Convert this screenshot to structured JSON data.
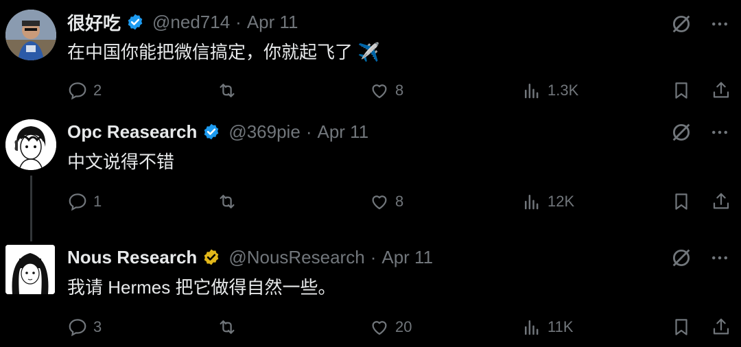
{
  "tweets": [
    {
      "name": "很好吃",
      "verified": "blue",
      "handle": "@ned714",
      "sep": "·",
      "time": "Apr 11",
      "text": "在中国你能把微信搞定，你就起飞了 ✈️",
      "replies": "2",
      "likes": "8",
      "views": "1.3K"
    },
    {
      "name": "Opc Reasearch",
      "verified": "blue",
      "handle": "@369pie",
      "sep": "·",
      "time": "Apr 11",
      "text": "中文说得不错",
      "replies": "1",
      "likes": "8",
      "views": "12K"
    },
    {
      "name": "Nous Research",
      "verified": "gold",
      "handle": "@NousResearch",
      "sep": "·",
      "time": "Apr 11",
      "text": "我请 Hermes 把它做得自然一些。",
      "replies": "3",
      "likes": "20",
      "views": "11K"
    }
  ],
  "colors": {
    "background": "#000000",
    "text": "#e7e9ea",
    "muted": "#71767b",
    "verified_blue": "#1d9bf0",
    "verified_gold": "#e2b719"
  },
  "icons": [
    "reply-icon",
    "retweet-icon",
    "like-icon",
    "views-icon",
    "bookmark-icon",
    "share-icon",
    "grok-icon",
    "more-icon",
    "verified-badge-icon"
  ]
}
